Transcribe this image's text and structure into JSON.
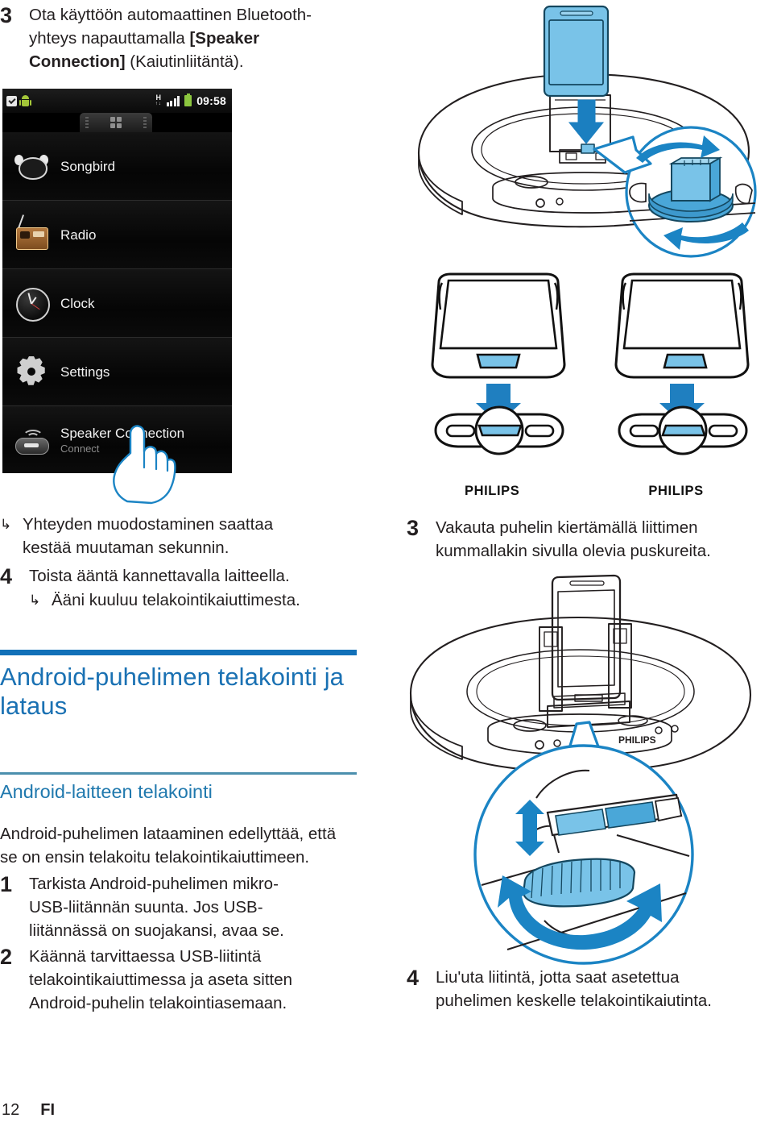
{
  "page": {
    "number": "12",
    "language": "FI"
  },
  "left_column": {
    "step3": {
      "number": "3",
      "text_before": "Ota käyttöön automaattinen Bluetooth-yhteys napauttamalla ",
      "bold_text": "[Speaker Connection]",
      "text_after": " (Kaiutinliitäntä)."
    },
    "phone_screenshot": {
      "statusbar": {
        "download_icon": "download-icon",
        "android_icon": "android-robot-icon",
        "network_type": "H",
        "network_sub": "↑↓",
        "signal_icon": "signal-bars-icon",
        "battery_icon": "battery-icon",
        "time": "09:58"
      },
      "tab_icon": "apps-grid-icon",
      "apps": [
        {
          "label": "Songbird",
          "sub": "",
          "icon": "songbird-icon"
        },
        {
          "label": "Radio",
          "sub": "",
          "icon": "radio-icon"
        },
        {
          "label": "Clock",
          "sub": "",
          "icon": "clock-icon"
        },
        {
          "label": "Settings",
          "sub": "",
          "icon": "gear-icon"
        },
        {
          "label": "Speaker Connection",
          "sub": "Connect",
          "icon": "speaker-dock-icon"
        }
      ],
      "cursor_icon": "hand-tap-icon"
    },
    "note1": {
      "arrow": "↳",
      "text": "Yhteyden muodostaminen saattaa kestää muutaman sekunnin."
    },
    "step4": {
      "number": "4",
      "text": "Toista ääntä kannettavalla laitteella."
    },
    "note2": {
      "arrow": "↳",
      "text": "Ääni kuuluu telakointikaiuttimesta."
    },
    "heading1": "Android-puhelimen telakointi ja lataus",
    "heading2": "Android-laitteen telakointi",
    "intro": "Android-puhelimen lataaminen edellyttää, että se on ensin telakoitu telakointikaiuttimeen.",
    "steps": [
      {
        "number": "1",
        "text": "Tarkista Android-puhelimen mikro-USB-liitännän suunta. Jos USB-liitännässä on suojakansi, avaa se."
      },
      {
        "number": "2",
        "text": "Käännä tarvittaessa USB-liitintä telakointikaiuttimessa ja aseta sitten Android-puhelin telakointiasemaan."
      }
    ]
  },
  "right_column": {
    "watermark_left": "PHILIPS",
    "watermark_right": "PHILIPS",
    "dock_brand": "PHILIPS",
    "step3": {
      "number": "3",
      "text": "Vakauta puhelin kiertämällä liittimen kummallakin sivulla olevia puskureita."
    },
    "step4": {
      "number": "4",
      "text": "Liu'uta liitintä, jotta saat asetettua puhelimen keskelle telakointikaiutinta."
    },
    "illustrations": {
      "top": "dock-with-phone-and-connector-callout",
      "connectors": "two-phone-bottom-usb-orientation-diagram",
      "bottom": "dock-with-phone-and-rotating-connector-callout"
    }
  },
  "colors": {
    "heading_blue": "#1a71b3",
    "subheading_blue": "#2079ae",
    "rule_thick": "#1170b8",
    "rule_thin": "#4b8fad",
    "art_blue": "#1b84c4",
    "art_fill": "#79c3e8",
    "text": "#231f20"
  }
}
